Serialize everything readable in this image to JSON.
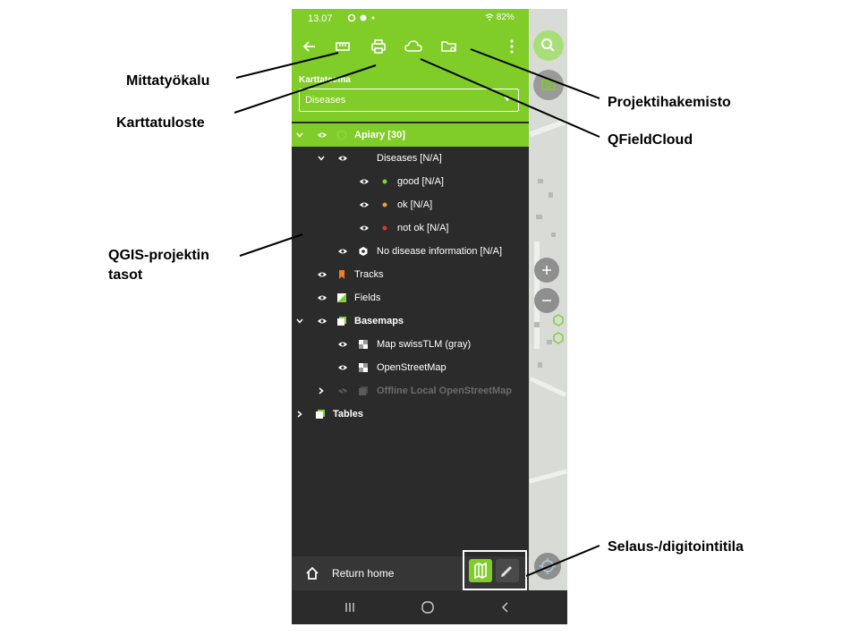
{
  "status_bar": {
    "time": "13.07",
    "battery": "82%"
  },
  "toolbar": {
    "back_icon": "arrow-left-icon",
    "measure_icon": "ruler-icon",
    "print_icon": "printer-icon",
    "cloud_icon": "cloud-icon",
    "project_folder_icon": "folder-settings-icon",
    "more_icon": "more-vertical-icon"
  },
  "map_theme": {
    "label": "Karttateema",
    "value": "Diseases"
  },
  "layers": [
    {
      "label": "Apiary [30]",
      "selected": true,
      "bold": true,
      "expanded": true
    },
    {
      "label": "Diseases [N/A]",
      "expanded": true
    },
    {
      "label": "good [N/A]",
      "symbol_color": "#7cd23a"
    },
    {
      "label": "ok [N/A]",
      "symbol_color": "#f0a030"
    },
    {
      "label": "not ok [N/A]",
      "symbol_color": "#e83030"
    },
    {
      "label": "No disease information [N/A]"
    },
    {
      "label": "Tracks",
      "symbol_color": "#f07c24"
    },
    {
      "label": "Fields",
      "symbol_color": "#7cd23a"
    },
    {
      "label": "Basemaps",
      "bold": true,
      "expanded": true
    },
    {
      "label": "Map swissTLM (gray)"
    },
    {
      "label": "OpenStreetMap"
    },
    {
      "label": "Offline Local OpenStreetMap",
      "dimmed": true,
      "expanded": false
    },
    {
      "label": "Tables",
      "bold": true,
      "expanded": false
    }
  ],
  "bottom": {
    "return_home": "Return home"
  },
  "annotations": {
    "measure": "Mittatyökalu",
    "print": "Karttatuloste",
    "layers_line1": "QGIS-projektin",
    "layers_line2": "tasot",
    "project_folder": "Projektihakemisto",
    "cloud": "QFieldCloud",
    "mode": "Selaus-/digitointitila"
  },
  "colors": {
    "accent": "#80cc28",
    "panel": "#2b2b2b"
  }
}
